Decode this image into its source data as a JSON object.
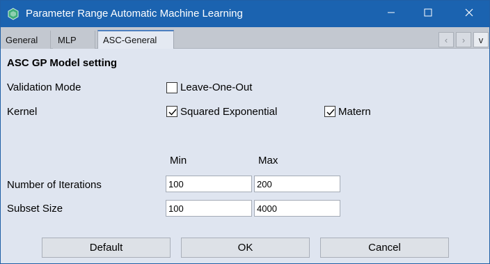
{
  "window": {
    "title": "Parameter Range Automatic Machine Learning",
    "icons": {
      "app": "app-logo-icon",
      "minimize": "minimize-icon",
      "maximize": "maximize-icon",
      "close": "close-icon"
    }
  },
  "tabs": [
    {
      "label": "General",
      "selected": false
    },
    {
      "label": "MLP",
      "selected": false
    },
    {
      "label": "ASC-General",
      "selected": true
    }
  ],
  "tab_nav": {
    "prev": "‹",
    "next": "›",
    "list": "v"
  },
  "section": {
    "title": "ASC GP Model setting",
    "validation_label": "Validation Mode",
    "leave_one_out": {
      "label": "Leave-One-Out",
      "checked": false
    },
    "kernel_label": "Kernel",
    "squared_exponential": {
      "label": "Squared Exponential",
      "checked": true
    },
    "matern": {
      "label": "Matern",
      "checked": true
    }
  },
  "ranges": {
    "min_header": "Min",
    "max_header": "Max",
    "iterations": {
      "label": "Number of Iterations",
      "min": "100",
      "max": "200"
    },
    "subset": {
      "label": "Subset Size",
      "min": "100",
      "max": "4000"
    }
  },
  "buttons": {
    "default": "Default",
    "ok": "OK",
    "cancel": "Cancel"
  },
  "colors": {
    "titlebar": "#1b63b0",
    "body": "#dfe5f0",
    "tabstrip": "#c3c8d0"
  }
}
